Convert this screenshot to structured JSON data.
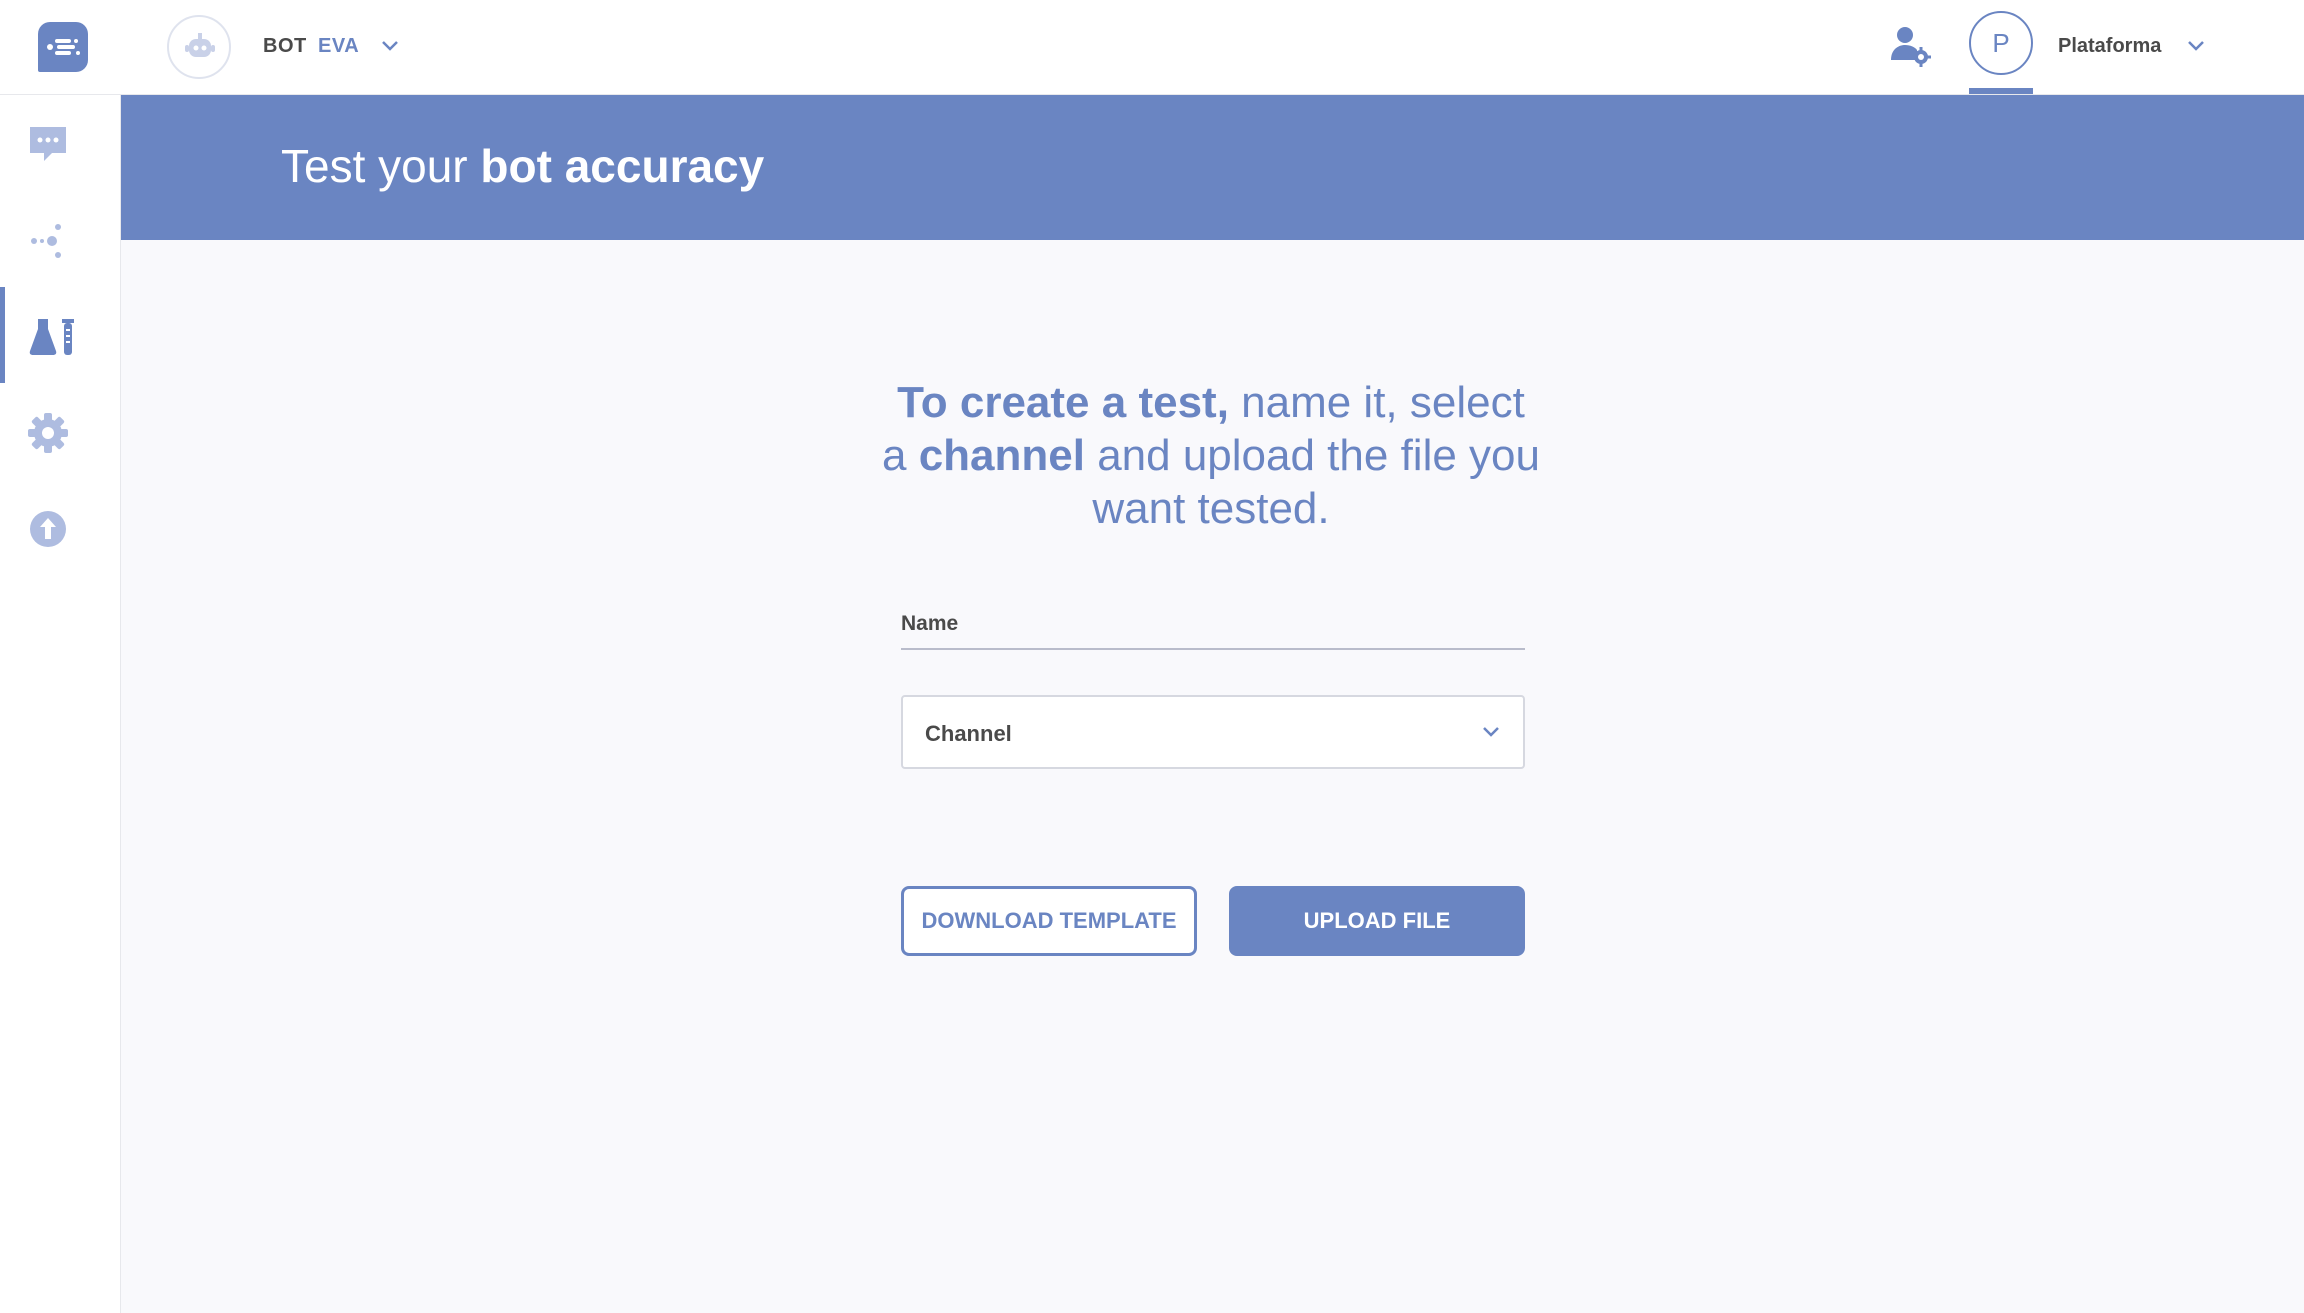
{
  "colors": {
    "accent": "#6a85c2",
    "background": "#f9f9fc",
    "text": "#4a4a4a"
  },
  "header": {
    "logo_icon": "chat-logo-icon",
    "bot_avatar_icon": "robot-icon",
    "bot_label": "BOT",
    "bot_name": "EVA",
    "user_settings_icon": "user-gear-icon",
    "profile_initial": "P",
    "profile_name": "Plataforma"
  },
  "sidebar": {
    "items": [
      {
        "name": "conversations",
        "icon": "chat-bubble-icon",
        "active": false
      },
      {
        "name": "flows",
        "icon": "nodes-icon",
        "active": false
      },
      {
        "name": "tests",
        "icon": "flask-icon",
        "active": true
      },
      {
        "name": "settings",
        "icon": "gear-icon",
        "active": false
      },
      {
        "name": "publish",
        "icon": "upload-icon",
        "active": false
      }
    ]
  },
  "banner": {
    "title_regular": "Test your ",
    "title_bold": "bot accuracy"
  },
  "main": {
    "headline": {
      "part1_bold": "To create a test,",
      "part2": " name it, select a ",
      "part3_bold": "channel",
      "part4": " and upload the file you want tested."
    },
    "name_field": {
      "label": "Name",
      "value": ""
    },
    "channel_select": {
      "placeholder": "Channel"
    },
    "download_button": "DOWNLOAD TEMPLATE",
    "upload_button": "UPLOAD FILE"
  }
}
